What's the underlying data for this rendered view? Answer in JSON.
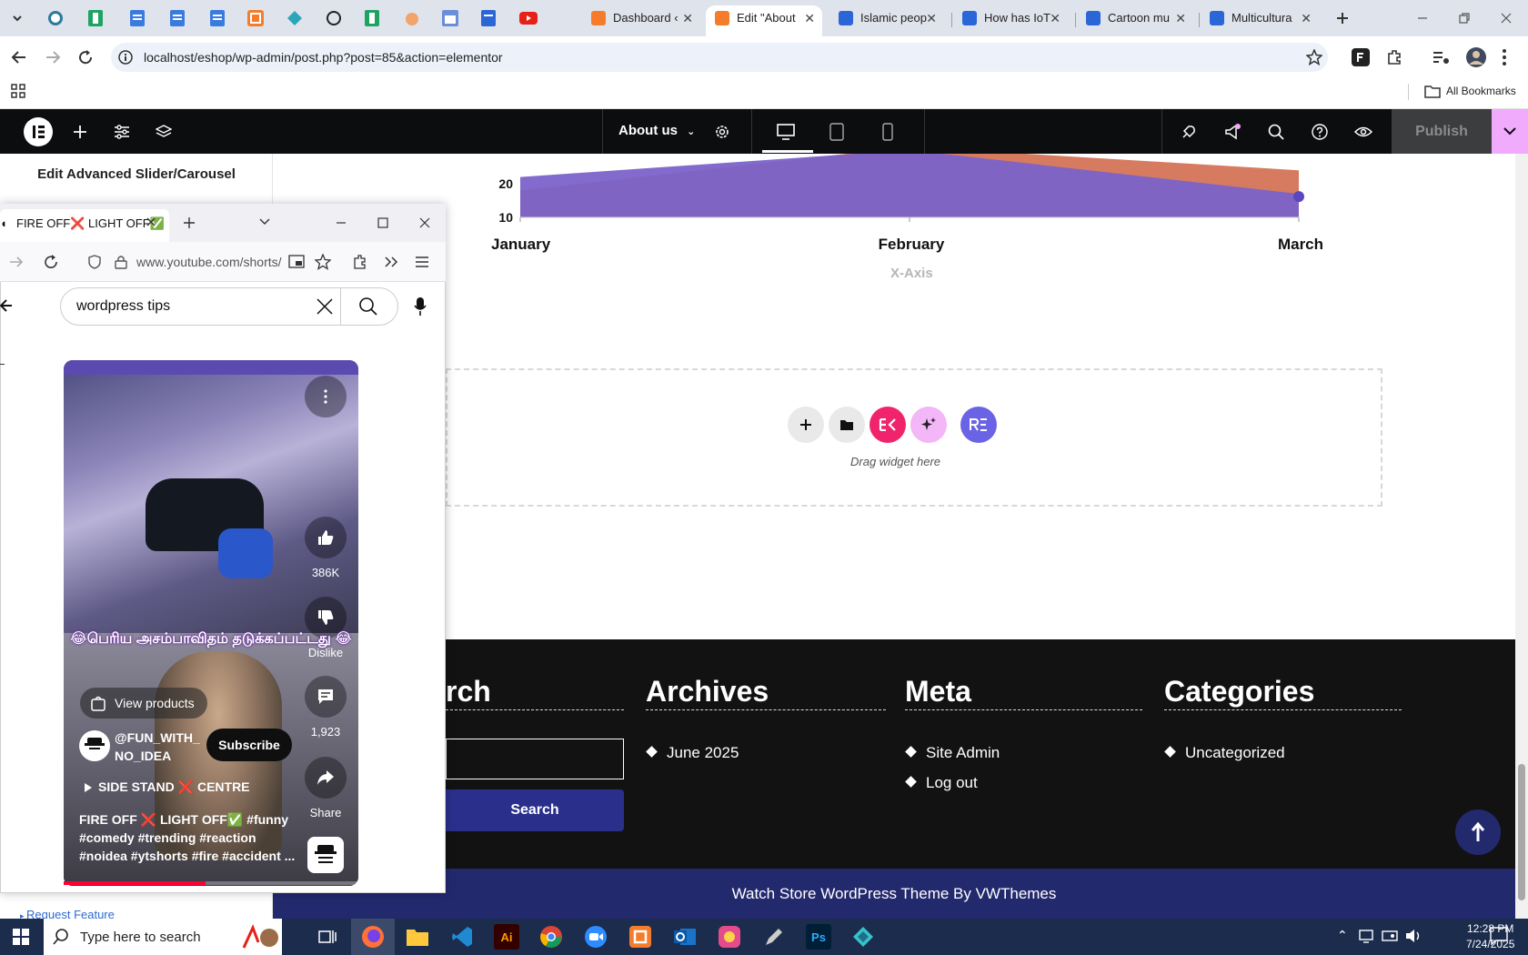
{
  "browser": {
    "tabs": [
      {
        "title": "Dashboard ‹",
        "active": false
      },
      {
        "title": "Edit \"About",
        "active": true
      },
      {
        "title": "Islamic peop",
        "active": false
      },
      {
        "title": "How has IoT",
        "active": false
      },
      {
        "title": "Cartoon mu",
        "active": false
      },
      {
        "title": "Multicultura",
        "active": false
      }
    ],
    "url": "localhost/eshop/wp-admin/post.php?post=85&action=elementor",
    "bookmarks_label": "All Bookmarks"
  },
  "elementor": {
    "page_selector": "About us",
    "publish_label": "Publish",
    "panel_title": "Edit Advanced Slider/Carousel",
    "request_feature": "Request Feature"
  },
  "chart_data": {
    "type": "area",
    "categories": [
      "January",
      "February",
      "March"
    ],
    "xlabel": "X-Axis",
    "y_ticks_visible": [
      20,
      10
    ],
    "series": [
      {
        "values": [
          22,
          30,
          17
        ],
        "color": "#7b63c9"
      },
      {
        "values": [
          18,
          31,
          24
        ],
        "color": "#d67b5f"
      }
    ]
  },
  "dropzone": {
    "drag_text": "Drag widget here"
  },
  "footer": {
    "search_heading": "rch",
    "search_button": "Search",
    "archives_heading": "Archives",
    "archives_items": [
      "June 2025"
    ],
    "meta_heading": "Meta",
    "meta_items": [
      "Site Admin",
      "Log out"
    ],
    "categories_heading": "Categories",
    "categories_items": [
      "Uncategorized"
    ],
    "credit": "Watch Store WordPress Theme By VWThemes"
  },
  "youtube": {
    "tab_title": "FIRE OFF❌ LIGHT OFF✅",
    "url": "www.youtube.com/shorts/",
    "search_query": "wordpress  tips",
    "like_count": "386K",
    "dislike_label": "Dislike",
    "comment_count": "1,923",
    "share_label": "Share",
    "tamil_title": "😂பெரிய அசம்பாவிதம் தடுக்கப்பட்டது 😂",
    "view_products": "View products",
    "channel_line1": "@FUN_WITH_",
    "channel_line2": "NO_IDEA",
    "subscribe_label": "Subscribe",
    "playlist_label": "SIDE STAND ❌ CENTRE",
    "caption": "FIRE OFF ❌ LIGHT OFF✅ #funny #comedy #trending #reaction #noidea #ytshorts #fire #accident ...",
    "progress": 0.48
  },
  "taskbar": {
    "search_placeholder": "Type here to search",
    "time": "12:28 PM",
    "date": "7/24/2025"
  }
}
